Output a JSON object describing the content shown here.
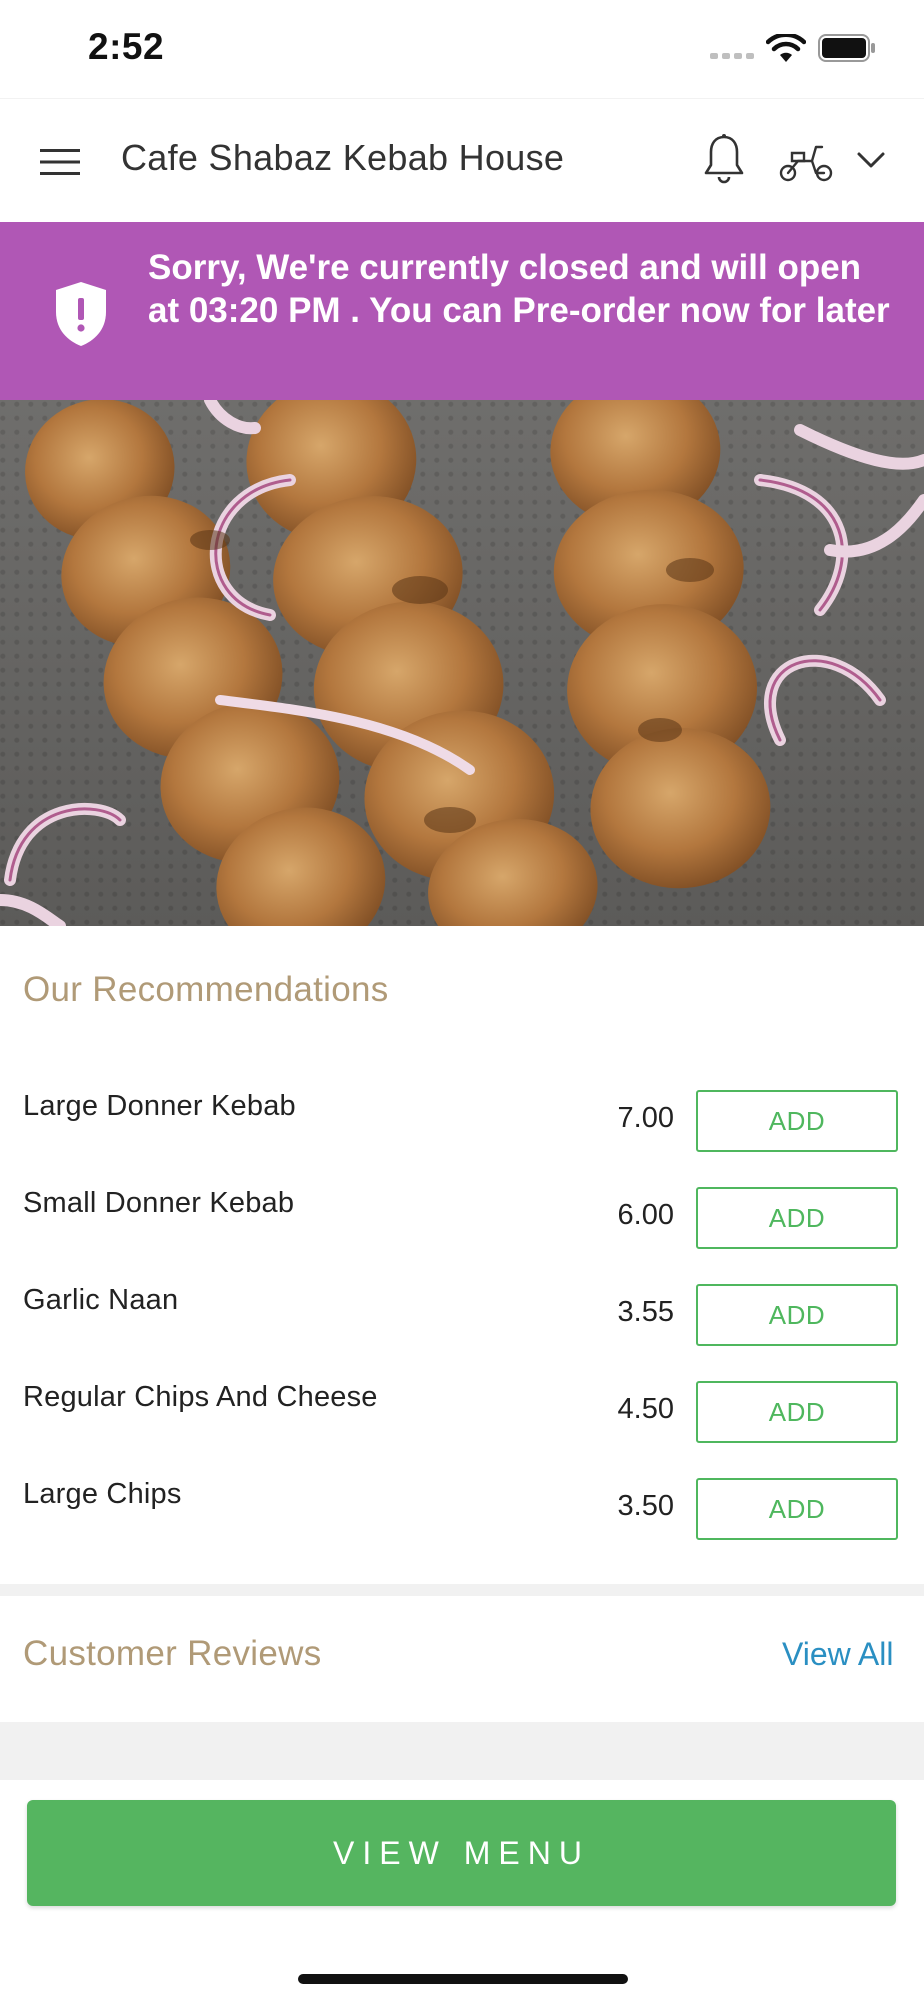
{
  "status_bar": {
    "time": "2:52"
  },
  "header": {
    "restaurant_name": "Cafe Shabaz Kebab House"
  },
  "banner": {
    "message": "Sorry, We're currently closed and will open at 03:20 PM . You can Pre-order now for later",
    "color": "#b057b5"
  },
  "recommendations": {
    "title": "Our Recommendations",
    "items": [
      {
        "name": "Large Donner Kebab",
        "price": "7.00",
        "button": "ADD"
      },
      {
        "name": "Small Donner Kebab",
        "price": "6.00",
        "button": "ADD"
      },
      {
        "name": "Garlic Naan",
        "price": "3.55",
        "button": "ADD"
      },
      {
        "name": "Regular Chips And Cheese",
        "price": "4.50",
        "button": "ADD"
      },
      {
        "name": "Large Chips",
        "price": "3.50",
        "button": "ADD"
      }
    ]
  },
  "reviews": {
    "title": "Customer Reviews",
    "view_all": "View All"
  },
  "footer": {
    "view_menu": "VIEW MENU"
  },
  "colors": {
    "accent_green": "#55b560",
    "section_title": "#b09a77",
    "link_blue": "#2a8fc2"
  }
}
